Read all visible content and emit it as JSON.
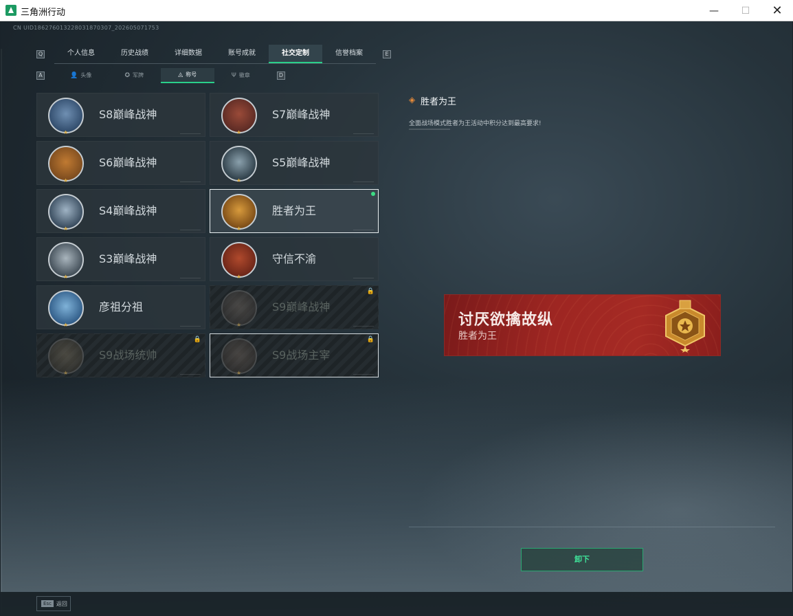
{
  "window": {
    "title": "三角洲行动",
    "min": "—",
    "max": "☐",
    "close": "✕"
  },
  "uid": "CN UID1862760132280318703​07_202605071753",
  "main_tabs": {
    "left_key": "Q",
    "right_key": "E",
    "items": [
      {
        "label": "个人信息",
        "active": false
      },
      {
        "label": "历史战绩",
        "active": false
      },
      {
        "label": "详细数据",
        "active": false
      },
      {
        "label": "账号成就",
        "active": false
      },
      {
        "label": "社交定制",
        "active": true
      },
      {
        "label": "信誉档案",
        "active": false
      }
    ]
  },
  "sub_tabs": {
    "left_key": "A",
    "right_key": "D",
    "items": [
      {
        "label": "头像",
        "icon": "person-icon",
        "glyph": "👤",
        "active": false
      },
      {
        "label": "军牌",
        "icon": "dogtag-icon",
        "glyph": "✪",
        "active": false
      },
      {
        "label": "称号",
        "icon": "title-icon",
        "glyph": "◬",
        "active": true
      },
      {
        "label": "徽章",
        "icon": "badge-icon",
        "glyph": "Ψ",
        "active": false
      }
    ]
  },
  "titles": [
    {
      "name": "S8巅峰战神",
      "badge": "s8-peak-badge",
      "colors": [
        "#2f4a6a",
        "#6f8fb2"
      ],
      "locked": false,
      "selected": false,
      "equipped": false
    },
    {
      "name": "S7巅峰战神",
      "badge": "s7-peak-badge",
      "colors": [
        "#5a2a24",
        "#9a4a38"
      ],
      "locked": false,
      "selected": false,
      "equipped": false
    },
    {
      "name": "S6巅峰战神",
      "badge": "s6-peak-badge",
      "colors": [
        "#7a4a1e",
        "#c07a32"
      ],
      "locked": false,
      "selected": false,
      "equipped": false
    },
    {
      "name": "S5巅峰战神",
      "badge": "s5-peak-badge",
      "colors": [
        "#2c3c46",
        "#8aa0ac"
      ],
      "locked": false,
      "selected": false,
      "equipped": false
    },
    {
      "name": "S4巅峰战神",
      "badge": "s4-peak-badge",
      "colors": [
        "#34475a",
        "#9fb3c4"
      ],
      "locked": false,
      "selected": false,
      "equipped": false
    },
    {
      "name": "胜者为王",
      "badge": "winner-king-badge",
      "colors": [
        "#7a4a16",
        "#d79a3c"
      ],
      "locked": false,
      "selected": true,
      "equipped": true
    },
    {
      "name": "S3巅峰战神",
      "badge": "s3-peak-badge",
      "colors": [
        "#3e4a54",
        "#a9b5bd"
      ],
      "locked": false,
      "selected": false,
      "equipped": false
    },
    {
      "name": "守信不渝",
      "badge": "keep-faith-badge",
      "colors": [
        "#6a2518",
        "#b0492c"
      ],
      "locked": false,
      "selected": false,
      "equipped": false
    },
    {
      "name": "彦祖分祖",
      "badge": "yanzu-badge",
      "colors": [
        "#2e5a86",
        "#7fb2d8"
      ],
      "locked": false,
      "selected": false,
      "equipped": false
    },
    {
      "name": "S9巅峰战神",
      "badge": "s9-peak-badge",
      "colors": [
        "#3a3634",
        "#6a625c"
      ],
      "locked": true,
      "selected": false,
      "equipped": false
    },
    {
      "name": "S9战场统帅",
      "badge": "s9-commander-badge",
      "colors": [
        "#3e3a32",
        "#6e6656"
      ],
      "locked": true,
      "selected": false,
      "equipped": false
    },
    {
      "name": "S9战场主宰",
      "badge": "s9-dominator-badge",
      "colors": [
        "#3a3532",
        "#675d56"
      ],
      "locked": true,
      "selected": false,
      "equipped": false,
      "outlined": true
    }
  ],
  "lock_glyph": "🔒",
  "star_glyph": "★",
  "detail": {
    "title": "胜者为王",
    "description": "全面战场模式胜者为王活动中积分达到最高要求!",
    "icon_glyph": "◈"
  },
  "nameplate": {
    "player_name": "讨厌欲擒故纵",
    "title": "胜者为王"
  },
  "unequip_label": "卸下",
  "bottom": {
    "esc_key": "Esc",
    "back_label": "返回"
  },
  "colors": {
    "accent": "#2ad08a",
    "equipped": "#3ddc84",
    "nameplate": "#a52a24"
  }
}
